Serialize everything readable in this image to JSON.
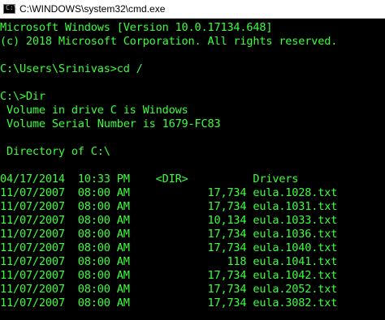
{
  "window": {
    "title": "C:\\WINDOWS\\system32\\cmd.exe",
    "icon": "cmd-icon",
    "icon_glyph": "C:\\"
  },
  "console": {
    "text_color": "#39ff39",
    "background_color": "#000000",
    "lines": [
      "Microsoft Windows [Version 10.0.17134.648]",
      "(c) 2018 Microsoft Corporation. All rights reserved.",
      "",
      "C:\\Users\\Srinivas>cd /",
      "",
      "C:\\>Dir",
      " Volume in drive C is Windows",
      " Volume Serial Number is 1679-FC83",
      "",
      " Directory of C:\\",
      "",
      "04/17/2014  10:33 PM    <DIR>          Drivers",
      "11/07/2007  08:00 AM            17,734 eula.1028.txt",
      "11/07/2007  08:00 AM            17,734 eula.1031.txt",
      "11/07/2007  08:00 AM            10,134 eula.1033.txt",
      "11/07/2007  08:00 AM            17,734 eula.1036.txt",
      "11/07/2007  08:00 AM            17,734 eula.1040.txt",
      "11/07/2007  08:00 AM               118 eula.1041.txt",
      "11/07/2007  08:00 AM            17,734 eula.1042.txt",
      "11/07/2007  08:00 AM            17,734 eula.2052.txt",
      "11/07/2007  08:00 AM            17,734 eula.3082.txt"
    ]
  }
}
